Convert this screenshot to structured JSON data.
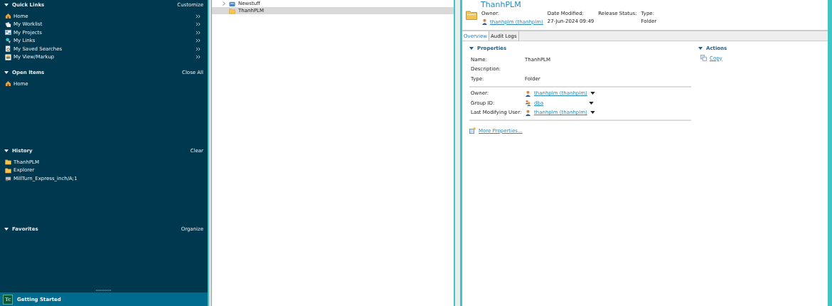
{
  "sections": [
    {
      "title": "Quick Links",
      "action": "Customize",
      "items": [
        {
          "label": "Home",
          "kind": "home",
          "more": true
        },
        {
          "label": "My Worklist",
          "kind": "worklist",
          "more": true
        },
        {
          "label": "My Projects",
          "kind": "projects",
          "more": true
        },
        {
          "label": "My Links",
          "kind": "links",
          "more": true
        },
        {
          "label": "My Saved Searches",
          "kind": "search",
          "more": true
        },
        {
          "label": "My View/Markup",
          "kind": "view",
          "more": true
        }
      ]
    },
    {
      "title": "Open Items",
      "action": "Close All",
      "items": [
        {
          "label": "Home",
          "kind": "home",
          "more": false
        }
      ]
    },
    {
      "title": "History",
      "action": "Clear",
      "items": [
        {
          "label": "ThanhPLM",
          "kind": "folder",
          "more": false
        },
        {
          "label": "Explorer",
          "kind": "folder",
          "more": false
        },
        {
          "label": "MillTurn_Express_inch/A;1",
          "kind": "item",
          "more": false
        }
      ]
    },
    {
      "title": "Favorites",
      "action": "Organize"
    }
  ],
  "getting_started": {
    "logo": "Tc",
    "label": "Getting Started"
  },
  "tree": [
    {
      "label": "Newstuff",
      "kind": "server",
      "expanded": false,
      "selected": false
    },
    {
      "label": "ThanhPLM",
      "kind": "folder",
      "selected": true
    }
  ],
  "object": {
    "title": "ThanhPLM",
    "header_fields": [
      {
        "label": "Owner:",
        "value": "thanhplm (thanhplm)",
        "kind": "user"
      },
      {
        "label": "Date Modified:",
        "value": "27-Jun-2024 09:49",
        "kind": "text"
      },
      {
        "label": "Release Status:"
      },
      {
        "label": "Type:",
        "value": "Folder",
        "kind": "text"
      }
    ]
  },
  "tabs": [
    {
      "label": "Overview",
      "selected": true
    },
    {
      "label": "Audit Logs",
      "selected": false
    }
  ],
  "properties": {
    "title": "Properties",
    "groups": [
      [
        {
          "label": "Name:",
          "value": "ThanhPLM",
          "kind": "text"
        },
        {
          "label": "Description:",
          "kind": "text"
        },
        {
          "label": "Type:",
          "value": "Folder",
          "kind": "text"
        }
      ],
      [
        {
          "label": "Owner:",
          "value": "thanhplm (thanhplm)",
          "kind": "user"
        },
        {
          "label": "Group ID:",
          "value": "dba",
          "kind": "group"
        },
        {
          "label": "Last Modifying User:",
          "value": "thanhplm (thanhplm)",
          "kind": "user"
        }
      ]
    ],
    "more": "More Properties..."
  },
  "actions": {
    "title": "Actions",
    "items": [
      {
        "label": "Copy"
      }
    ]
  }
}
